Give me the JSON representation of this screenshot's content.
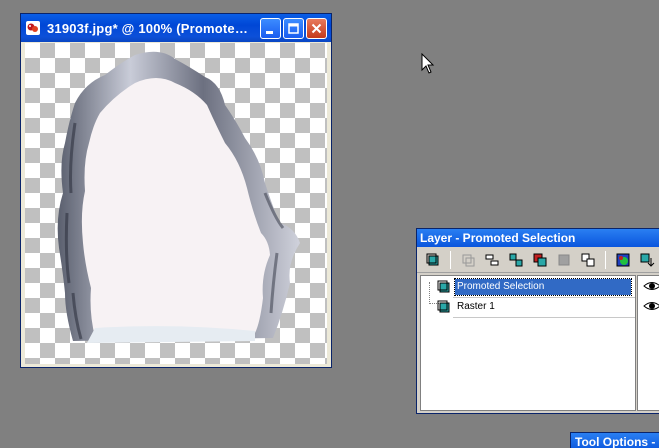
{
  "image_window": {
    "title": "31903f.jpg* @ 100% (Promote…",
    "buttons": [
      "minimize",
      "maximize",
      "close"
    ]
  },
  "layer_palette": {
    "title": "Layer - Promoted Selection",
    "toolbar_icons": [
      "new-raster-layer-icon",
      "new-vector-layer-icon",
      "new-layer-group-icon",
      "merge-layers-icon",
      "duplicate-layer-icon",
      "delete-layer-icon",
      "layer-properties-icon",
      "new-mask-icon",
      "new-adjustment-layer-icon",
      "link-layer-icon"
    ],
    "layers": [
      {
        "name": "Promoted Selection",
        "selected": true,
        "visible": true
      },
      {
        "name": "Raster 1",
        "selected": false,
        "visible": true
      }
    ]
  },
  "tool_options": {
    "title": "Tool Options - N"
  },
  "colors": {
    "desktop": "#808080",
    "xp_blue": "#0a5ee6",
    "selection": "#316ac5"
  }
}
